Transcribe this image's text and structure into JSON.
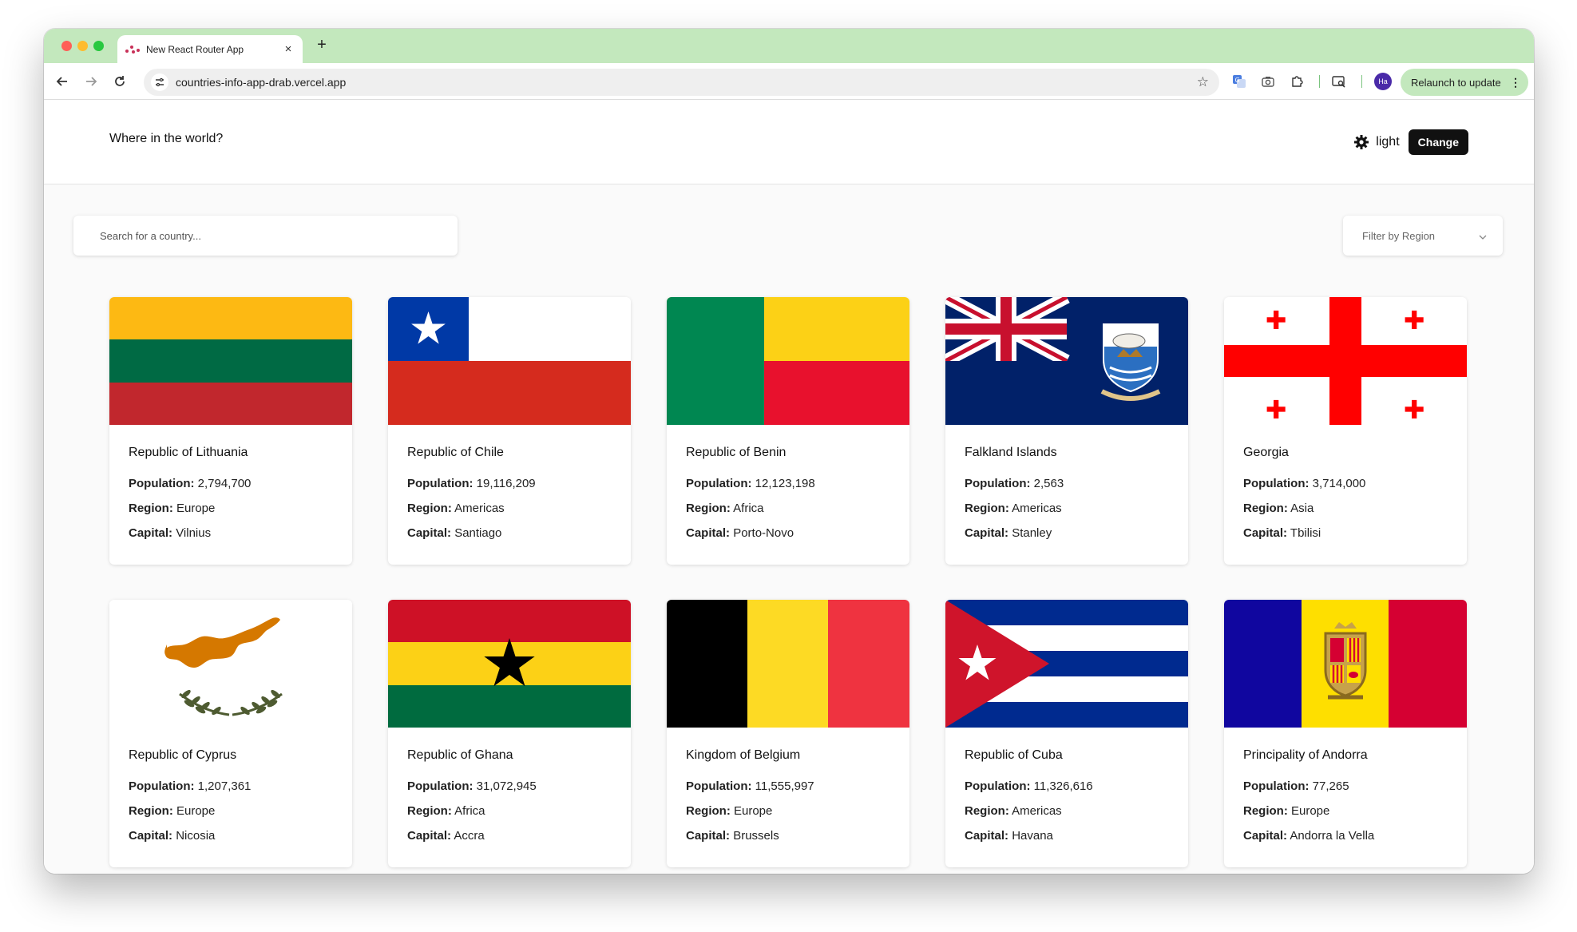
{
  "browser": {
    "tab_title": "New React Router App",
    "url": "countries-info-app-drab.vercel.app",
    "avatar_initials": "Ha",
    "relaunch_label": "Relaunch to update"
  },
  "header": {
    "title": "Where in the world?",
    "theme_label": "light",
    "change_button": "Change"
  },
  "search": {
    "placeholder": "Search for a country..."
  },
  "filter": {
    "label": "Filter by Region"
  },
  "labels": {
    "population": "Population:",
    "region": "Region:",
    "capital": "Capital:"
  },
  "countries": [
    {
      "name": "Republic of Lithuania",
      "population": "2,794,700",
      "region": "Europe",
      "capital": "Vilnius",
      "flag": "lithuania-flag"
    },
    {
      "name": "Republic of Chile",
      "population": "19,116,209",
      "region": "Americas",
      "capital": "Santiago",
      "flag": "chile-flag"
    },
    {
      "name": "Republic of Benin",
      "population": "12,123,198",
      "region": "Africa",
      "capital": "Porto-Novo",
      "flag": "benin-flag"
    },
    {
      "name": "Falkland Islands",
      "population": "2,563",
      "region": "Americas",
      "capital": "Stanley",
      "flag": "falkland-islands-flag"
    },
    {
      "name": "Georgia",
      "population": "3,714,000",
      "region": "Asia",
      "capital": "Tbilisi",
      "flag": "georgia-flag"
    },
    {
      "name": "Republic of Cyprus",
      "population": "1,207,361",
      "region": "Europe",
      "capital": "Nicosia",
      "flag": "cyprus-flag"
    },
    {
      "name": "Republic of Ghana",
      "population": "31,072,945",
      "region": "Africa",
      "capital": "Accra",
      "flag": "ghana-flag"
    },
    {
      "name": "Kingdom of Belgium",
      "population": "11,555,997",
      "region": "Europe",
      "capital": "Brussels",
      "flag": "belgium-flag"
    },
    {
      "name": "Republic of Cuba",
      "population": "11,326,616",
      "region": "Americas",
      "capital": "Havana",
      "flag": "cuba-flag"
    },
    {
      "name": "Principality of Andorra",
      "population": "77,265",
      "region": "Europe",
      "capital": "Andorra la Vella",
      "flag": "andorra-flag"
    }
  ],
  "colors": {
    "tab_strip": "#c3e8bd",
    "change_button_bg": "#111111",
    "page_bg": "#fafafa"
  }
}
